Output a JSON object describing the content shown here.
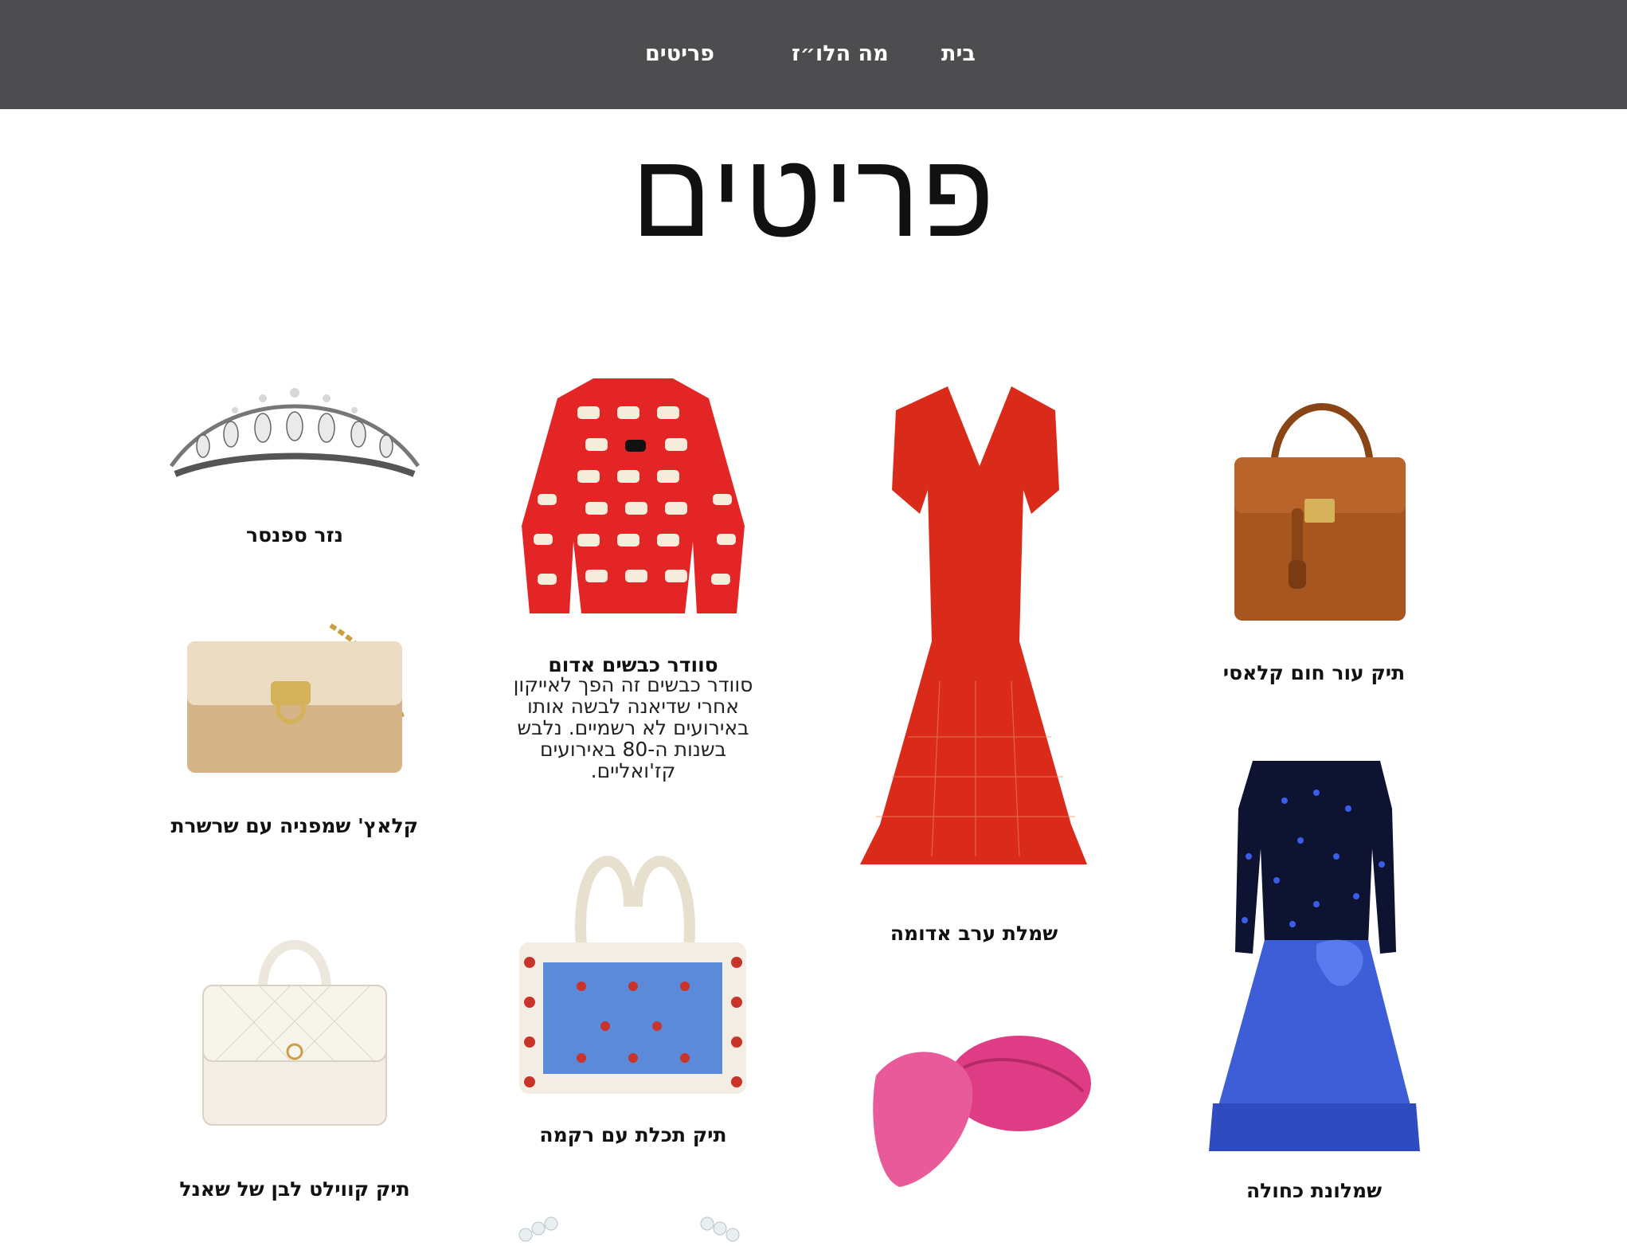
{
  "nav": {
    "home": "בית",
    "about": "מה הלו״ז",
    "items": "פריטים"
  },
  "page": {
    "title": "פריטים"
  },
  "products": {
    "handbag_brown": "תיק עור חום קלאסי",
    "dress_red": "שמלת ערב אדומה",
    "sweater_sheep": "סוודר כבשים אדום",
    "sweater_sheep_desc": "סוודר כבשים זה הפך לאייקון אחרי שדיאנה לבשה אותו באירועים לא רשמיים. נלבש בשנות ה-80 באירועים קז'ואליים.",
    "tiara": "נזר ספנסר",
    "clutch_champagne": "קלאץ' שמפניה עם שרשרת",
    "dress_blue": "שמלונת כחולה",
    "bag_embroidered": "תיק תכלת עם רקמה",
    "bag_chanel_white": "תיק קווילט לבן של שאנל"
  },
  "colors": {
    "nav_bg": "#4d4c4f",
    "red": "#e42525",
    "brown": "#a0521e",
    "blue": "#3052d6",
    "pink": "#e0407f"
  }
}
